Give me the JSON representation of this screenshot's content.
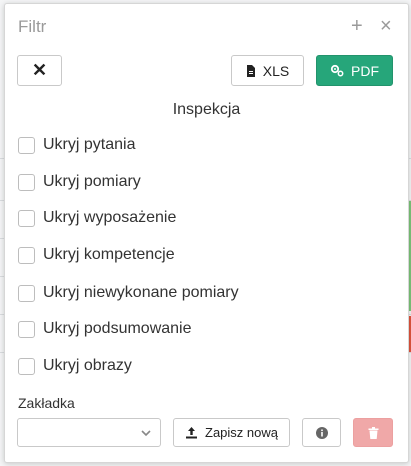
{
  "dialog": {
    "title": "Filtr",
    "header_icons": {
      "add": "+",
      "close": "×"
    }
  },
  "toolbar": {
    "close_symbol": "✕",
    "xls_label": "XLS",
    "pdf_label": "PDF"
  },
  "section_title": "Inspekcja",
  "checkboxes": [
    {
      "label": "Ukryj pytania",
      "checked": false
    },
    {
      "label": "Ukryj pomiary",
      "checked": false
    },
    {
      "label": "Ukryj wyposażenie",
      "checked": false
    },
    {
      "label": "Ukryj kompetencje",
      "checked": false
    },
    {
      "label": "Ukryj niewykonane pomiary",
      "checked": false
    },
    {
      "label": "Ukryj podsumowanie",
      "checked": false
    },
    {
      "label": "Ukryj obrazy",
      "checked": false
    }
  ],
  "bookmark": {
    "label": "Zakładka",
    "select_value": "",
    "save_label": "Zapisz nową"
  },
  "colors": {
    "pdf_button": "#26a67a",
    "delete_button": "#f0a8a8"
  }
}
